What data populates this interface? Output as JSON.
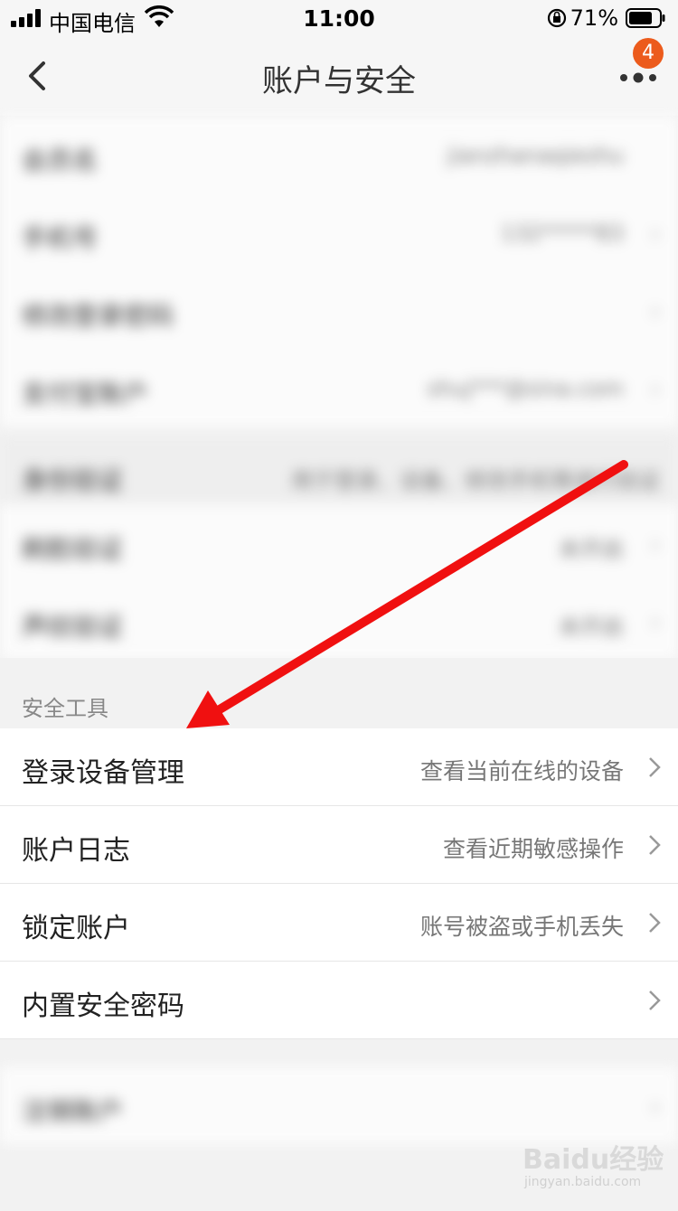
{
  "status_bar": {
    "carrier": "中国电信",
    "time": "11:00",
    "battery": "71%"
  },
  "nav": {
    "title": "账户与安全",
    "badge_count": "4"
  },
  "blurred_rows": [
    {
      "label": "会员名",
      "value": "jianzhanaqieshu"
    },
    {
      "label": "手机号",
      "value": "132*****83"
    },
    {
      "label": "修改登录密码",
      "value": ""
    },
    {
      "label": "支付宝账户",
      "value": "shuj***@sina.com"
    },
    {
      "label": "身份验证",
      "value": "用于登录、设备、修改手机等进行验证"
    },
    {
      "label": "刷脸验证",
      "value": "未开启"
    },
    {
      "label": "声纹验证",
      "value": "未开启"
    }
  ],
  "security_tools": {
    "header": "安全工具",
    "items": [
      {
        "label": "登录设备管理",
        "desc": "查看当前在线的设备"
      },
      {
        "label": "账户日志",
        "desc": "查看近期敏感操作"
      },
      {
        "label": "锁定账户",
        "desc": "账号被盗或手机丢失"
      },
      {
        "label": "内置安全密码",
        "desc": ""
      }
    ]
  },
  "bottom_row": {
    "label": "注销账户"
  },
  "watermark": {
    "brand": "Baidu经验",
    "url": "jingyan.baidu.com"
  },
  "colors": {
    "badge": "#ec5b1c",
    "arrow": "#f01010"
  },
  "icons": [
    "signal-icon",
    "wifi-icon",
    "rotation-lock-icon",
    "battery-icon",
    "back-icon",
    "more-icon",
    "chevron-right-icon",
    "arrow-annotation"
  ]
}
